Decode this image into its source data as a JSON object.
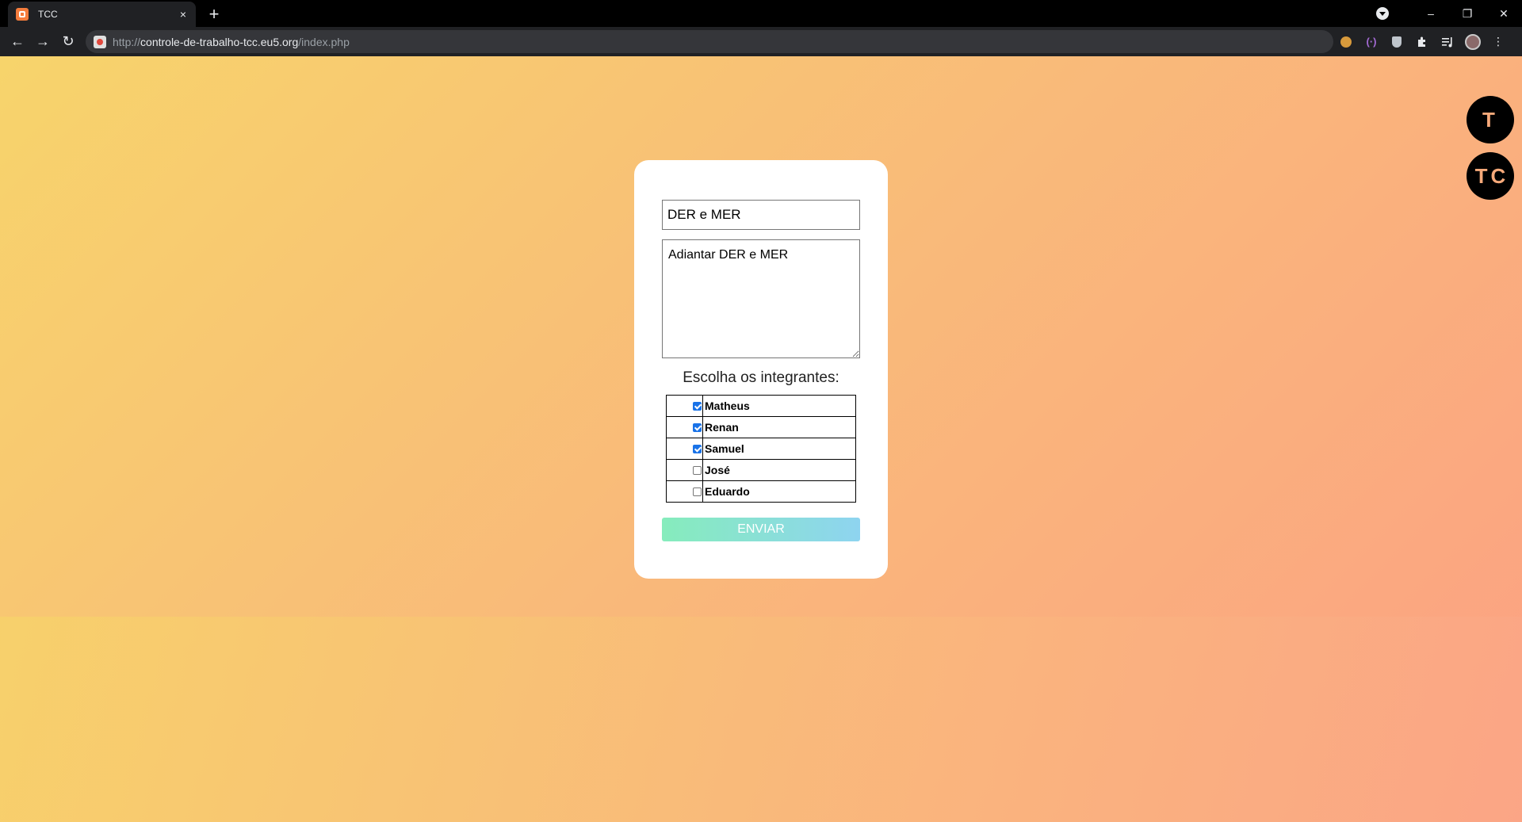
{
  "browser": {
    "tab_title": "TCC",
    "tab_close": "×",
    "new_tab": "+",
    "url_scheme": "http://",
    "url_host": "controle-de-trabalho-tcc.eu5.org",
    "url_path": "/index.php",
    "window_controls": {
      "minimize": "–",
      "restore": "❐",
      "close": "✕"
    },
    "nav": {
      "back": "←",
      "forward": "→",
      "reload": "↻"
    },
    "ext_brackets": "(·)",
    "menu": "⋮"
  },
  "form": {
    "title_value": "DER e MER",
    "description_value": "Adiantar DER e MER",
    "members_heading": "Escolha os integrantes:",
    "members": [
      {
        "name": "Matheus",
        "checked": true
      },
      {
        "name": "Renan",
        "checked": true
      },
      {
        "name": "Samuel",
        "checked": true
      },
      {
        "name": "José",
        "checked": false
      },
      {
        "name": "Eduardo",
        "checked": false
      }
    ],
    "submit_label": "ENVIAR"
  },
  "side_badges": {
    "first": "T",
    "second": "TC"
  },
  "colors": {
    "checkbox_checked": "#1a73e8",
    "button_gradient_start": "#86ecbc",
    "button_gradient_end": "#8ed4f0",
    "background_start": "#f7d46b",
    "background_end": "#fca083"
  }
}
